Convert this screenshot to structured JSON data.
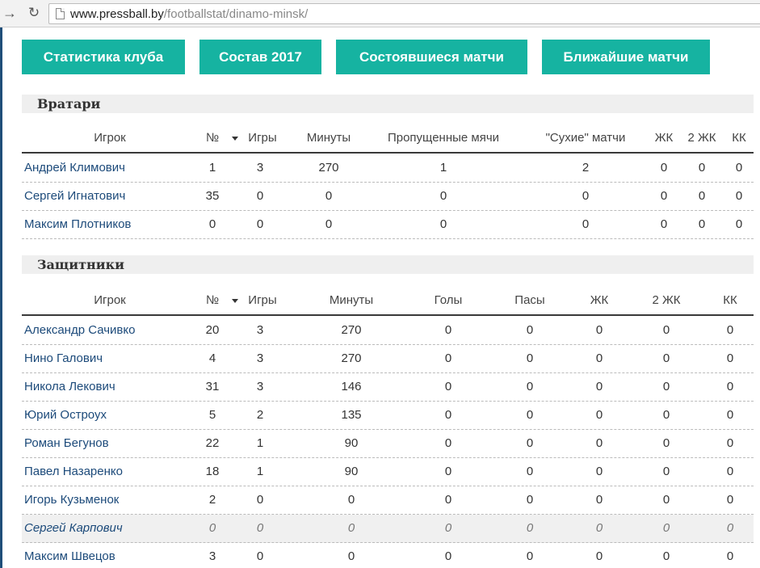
{
  "browser": {
    "url_host": "www.pressball.by",
    "url_path": "/footballstat/dinamo-minsk/"
  },
  "tabs": [
    {
      "label": "Статистика клуба"
    },
    {
      "label": "Состав 2017"
    },
    {
      "label": "Состоявшиеся матчи"
    },
    {
      "label": "Ближайшие матчи"
    }
  ],
  "goalkeepers": {
    "title": "Вратари",
    "columns": [
      "Игрок",
      "№",
      "Игры",
      "Минуты",
      "Пропущенные мячи",
      "\"Сухие\" матчи",
      "ЖК",
      "2 ЖК",
      "КК"
    ],
    "rows": [
      [
        "Андрей Климович",
        "1",
        "3",
        "270",
        "1",
        "2",
        "0",
        "0",
        "0"
      ],
      [
        "Сергей Игнатович",
        "35",
        "0",
        "0",
        "0",
        "0",
        "0",
        "0",
        "0"
      ],
      [
        "Максим Плотников",
        "0",
        "0",
        "0",
        "0",
        "0",
        "0",
        "0",
        "0"
      ]
    ]
  },
  "defenders": {
    "title": "Защитники",
    "columns": [
      "Игрок",
      "№",
      "Игры",
      "Минуты",
      "Голы",
      "Пасы",
      "ЖК",
      "2 ЖК",
      "КК"
    ],
    "rows": [
      [
        "Александр Сачивко",
        "20",
        "3",
        "270",
        "0",
        "0",
        "0",
        "0",
        "0"
      ],
      [
        "Нино Галович",
        "4",
        "3",
        "270",
        "0",
        "0",
        "0",
        "0",
        "0"
      ],
      [
        "Никола Лекович",
        "31",
        "3",
        "146",
        "0",
        "0",
        "0",
        "0",
        "0"
      ],
      [
        "Юрий Остроух",
        "5",
        "2",
        "135",
        "0",
        "0",
        "0",
        "0",
        "0"
      ],
      [
        "Роман Бегунов",
        "22",
        "1",
        "90",
        "0",
        "0",
        "0",
        "0",
        "0"
      ],
      [
        "Павел Назаренко",
        "18",
        "1",
        "90",
        "0",
        "0",
        "0",
        "0",
        "0"
      ],
      [
        "Игорь Кузьменок",
        "2",
        "0",
        "0",
        "0",
        "0",
        "0",
        "0",
        "0"
      ],
      [
        "Сергей Карпович",
        "0",
        "0",
        "0",
        "0",
        "0",
        "0",
        "0",
        "0"
      ],
      [
        "Максим Швецов",
        "3",
        "0",
        "0",
        "0",
        "0",
        "0",
        "0",
        "0"
      ]
    ]
  }
}
